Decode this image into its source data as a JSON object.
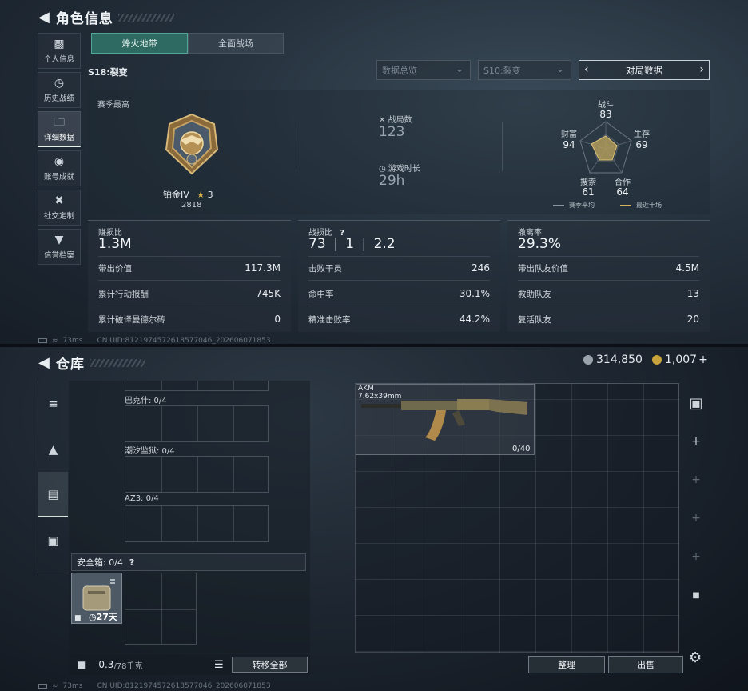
{
  "top": {
    "title": "角色信息",
    "sidebar": [
      {
        "icon": "bar-chart-icon",
        "label": "个人信息"
      },
      {
        "icon": "history-icon",
        "label": "历史战绩"
      },
      {
        "icon": "folder-icon",
        "label": "详细数据",
        "active": true
      },
      {
        "icon": "medal-icon",
        "label": "账号成就"
      },
      {
        "icon": "tools-icon",
        "label": "社交定制"
      },
      {
        "icon": "shield-icon",
        "label": "信誉档案"
      }
    ],
    "tabs": [
      "烽火地带",
      "全面战场"
    ],
    "season_label": "S18:裂变",
    "dropdown_1": "数据总览",
    "dropdown_2": "S10:裂变",
    "match_selector": "对局数据",
    "season_best_label": "赛季最高",
    "rank_name": "铂金IV",
    "rank_stars": "3",
    "rank_score": "2818",
    "matches_label": "战局数",
    "matches_value": "123",
    "playtime_label": "游戏时长",
    "playtime_value": "29h",
    "radar": {
      "combat_label": "战斗",
      "combat_value": "83",
      "wealth_label": "财富",
      "wealth_value": "94",
      "survival_label": "生存",
      "survival_value": "69",
      "search_label": "搜索",
      "search_value": "61",
      "coop_label": "合作",
      "coop_value": "64",
      "legend_season": "赛季平均",
      "legend_recent": "最近十场"
    },
    "card1": {
      "title": "赚损比",
      "big": "1.3M",
      "rows": [
        {
          "label": "带出价值",
          "value": "117.3M"
        },
        {
          "label": "累计行动报酬",
          "value": "745K"
        },
        {
          "label": "累计破译曼德尔砖",
          "value": "0"
        }
      ]
    },
    "card2": {
      "title": "战损比",
      "help": "?",
      "k": "73",
      "d": "1",
      "kd": "2.2",
      "rows": [
        {
          "label": "击败干员",
          "value": "246"
        },
        {
          "label": "命中率",
          "value": "30.1%"
        },
        {
          "label": "精准击败率",
          "value": "44.2%"
        }
      ]
    },
    "card3": {
      "title": "撤离率",
      "big": "29.3%",
      "rows": [
        {
          "label": "带出队友价值",
          "value": "4.5M"
        },
        {
          "label": "救助队友",
          "value": "13"
        },
        {
          "label": "复活队友",
          "value": "20"
        }
      ]
    },
    "status": {
      "ping": "73ms",
      "uid": "CN UID:8121974572618577046_202606071853"
    }
  },
  "bottom": {
    "title": "仓库",
    "currency_silver": "314,850",
    "currency_gold": "1,007",
    "currency_plus": "+",
    "slots": [
      {
        "label": "巴克什: 0/4"
      },
      {
        "label": "潮汐监狱: 0/4"
      },
      {
        "label": "AZ3: 0/4"
      }
    ],
    "safebox_label": "安全箱: 0/4",
    "safebox_help": "?",
    "safebox_timer": "27天",
    "weight": "0.3",
    "weight_max": "/78千克",
    "transfer_all": "转移全部",
    "weapon_name": "AKM",
    "weapon_caliber": "7.62x39mm",
    "weapon_ammo": "0/40",
    "sort_button": "整理",
    "sell_button": "出售",
    "status": {
      "ping": "73ms",
      "uid": "CN UID:8121974572618577046_202606071853"
    }
  },
  "colors": {
    "accent_teal": "#2f6a62",
    "gold": "#c8a23a",
    "radar_fill": "#b9a15c"
  }
}
